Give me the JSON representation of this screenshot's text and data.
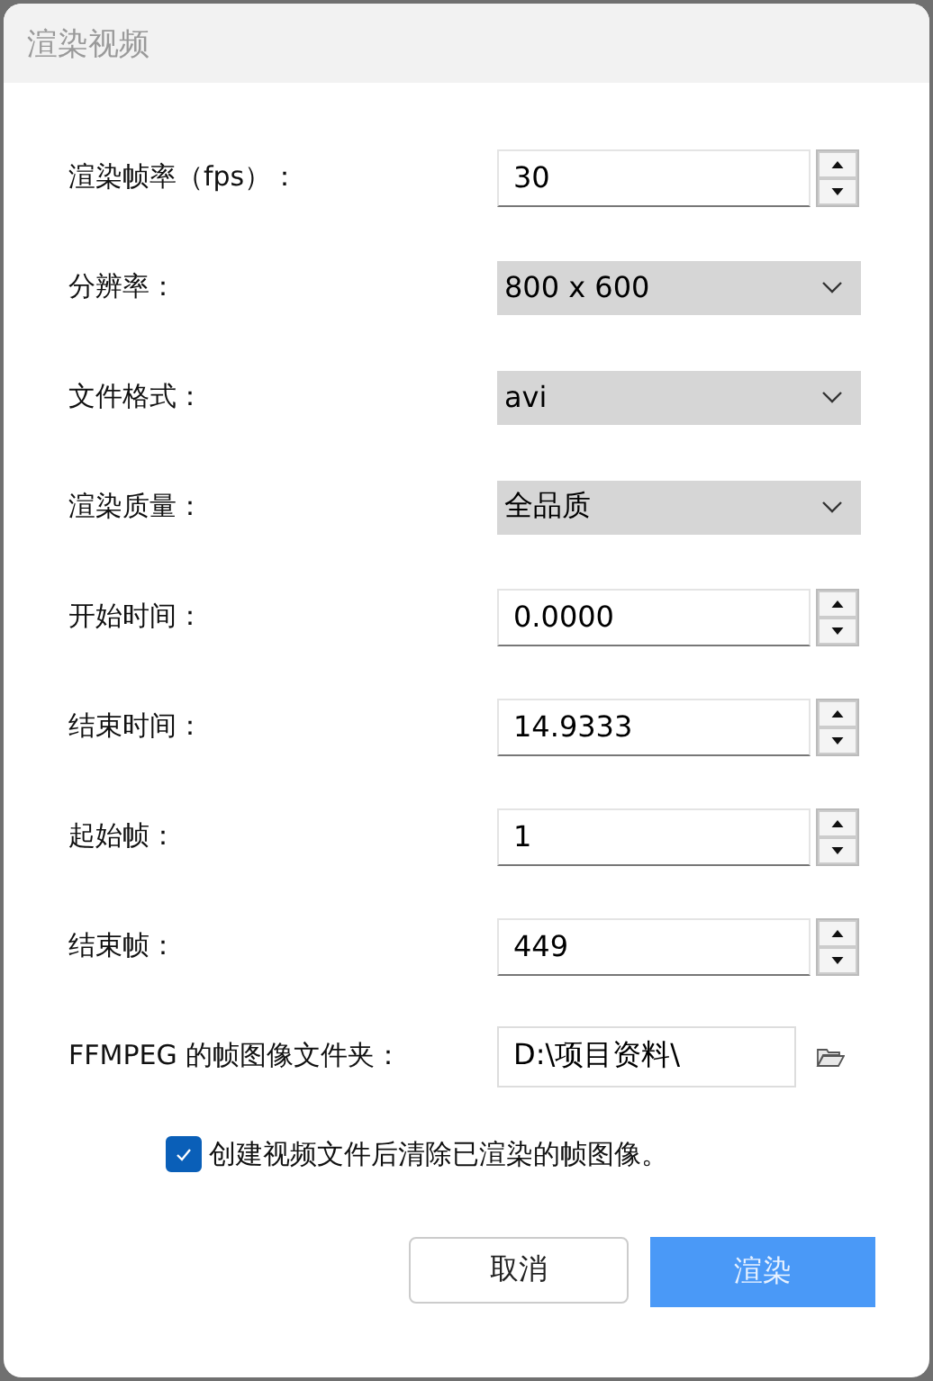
{
  "window": {
    "title": "渲染视频"
  },
  "fields": [
    {
      "kind": "spinner",
      "label": "渲染帧率（fps）：",
      "value": "30"
    },
    {
      "kind": "dropdown",
      "label": "分辨率：",
      "value": "800 x 600"
    },
    {
      "kind": "dropdown",
      "label": "文件格式：",
      "value": "avi"
    },
    {
      "kind": "dropdown",
      "label": "渲染质量：",
      "value": "全品质"
    },
    {
      "kind": "spinner",
      "label": "开始时间：",
      "value": "0.0000"
    },
    {
      "kind": "spinner",
      "label": "结束时间：",
      "value": "14.9333"
    },
    {
      "kind": "spinner",
      "label": "起始帧：",
      "value": "1"
    },
    {
      "kind": "spinner",
      "label": "结束帧：",
      "value": "449"
    },
    {
      "kind": "folder",
      "label": "FFMPEG 的帧图像文件夹：",
      "value": "D:\\项目资料\\"
    }
  ],
  "checkbox": {
    "label": "创建视频文件后清除已渲染的帧图像。",
    "checked": true
  },
  "buttons": [
    {
      "label": "取消",
      "kind": "secondary"
    },
    {
      "label": "渲染",
      "kind": "primary"
    }
  ]
}
